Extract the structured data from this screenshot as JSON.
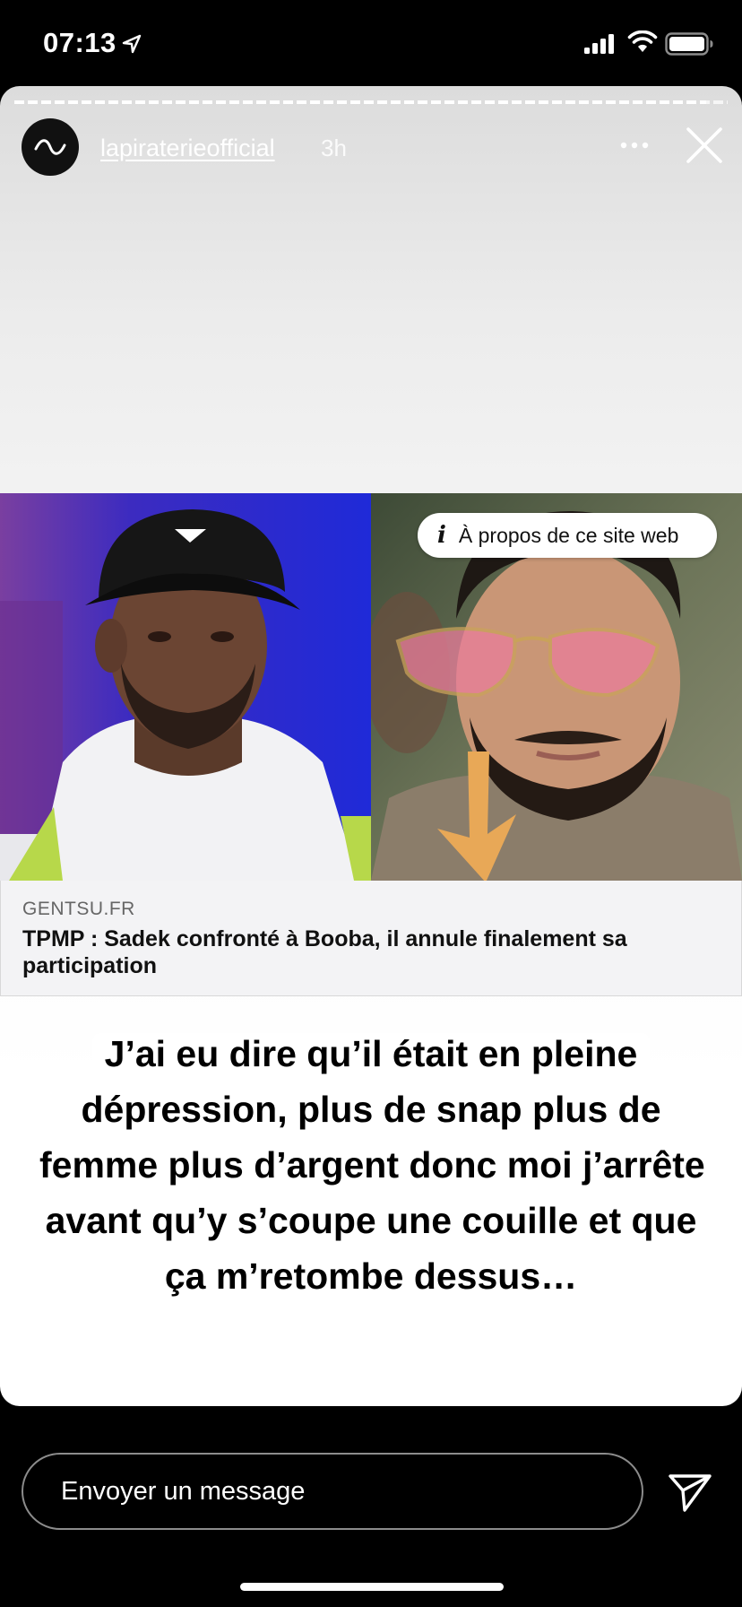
{
  "status_bar": {
    "time": "07:13",
    "icons": [
      "location-arrow-icon",
      "signal-icon",
      "wifi-icon",
      "battery-icon"
    ]
  },
  "story": {
    "username": "lapiraterieofficial",
    "time_ago": "3h",
    "progress": 0.97,
    "icons": [
      "avatar-wave-icon",
      "more-icon",
      "close-icon"
    ]
  },
  "article": {
    "about_label": "À propos de ce site web",
    "site": "GENTSU.FR",
    "headline": "TPMP : Sadek confronté à Booba, il annule finalement sa participation",
    "arrow_color": "#E8A857"
  },
  "overlay_text": "J’ai eu dire qu’il était en pleine dépression, plus de snap plus de femme plus d’argent donc moi j’arrête avant qu’y s’coupe une couille et que ça m’retombe dessus…",
  "message": {
    "placeholder": "Envoyer un message"
  },
  "colors": {
    "background": "#000000",
    "overlay_bg": "#FFFFFF"
  }
}
